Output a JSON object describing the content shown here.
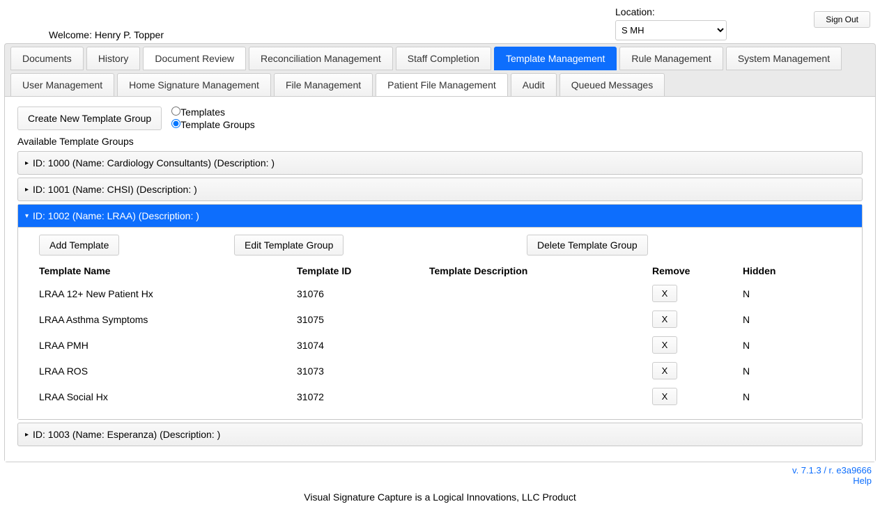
{
  "header": {
    "welcome_label": "Welcome:",
    "user_name": "Henry P. Topper",
    "location_label": "Location:",
    "location_value": "S MH",
    "signout": "Sign Out"
  },
  "tabs_row1": [
    "Documents",
    "History",
    "Document Review",
    "Reconciliation Management",
    "Staff Completion",
    "Template Management",
    "Rule Management",
    "System Management"
  ],
  "tabs_row2": [
    "User Management",
    "Home Signature Management",
    "File Management",
    "Patient File Management",
    "Audit",
    "Queued Messages"
  ],
  "active_tab": "Template Management",
  "white_tabs": [
    "Document Review",
    "Patient File Management"
  ],
  "content": {
    "create_btn": "Create New Template Group",
    "radio_templates": "Templates",
    "radio_groups": "Template Groups",
    "available_label": "Available Template Groups"
  },
  "groups": [
    {
      "header": "ID: 1000 (Name: Cardiology Consultants) (Description: )",
      "expanded": false
    },
    {
      "header": "ID: 1001 (Name: CHSI) (Description: )",
      "expanded": false
    },
    {
      "header": "ID: 1002 (Name: LRAA) (Description: )",
      "expanded": true,
      "actions": {
        "add": "Add Template",
        "edit": "Edit Template Group",
        "delete": "Delete Template Group"
      },
      "columns": {
        "name": "Template Name",
        "id": "Template ID",
        "desc": "Template Description",
        "remove": "Remove",
        "hidden": "Hidden"
      },
      "rows": [
        {
          "name": "LRAA 12+ New Patient Hx",
          "id": "31076",
          "desc": "",
          "remove": "X",
          "hidden": "N"
        },
        {
          "name": "LRAA Asthma Symptoms",
          "id": "31075",
          "desc": "",
          "remove": "X",
          "hidden": "N"
        },
        {
          "name": "LRAA PMH",
          "id": "31074",
          "desc": "",
          "remove": "X",
          "hidden": "N"
        },
        {
          "name": "LRAA ROS",
          "id": "31073",
          "desc": "",
          "remove": "X",
          "hidden": "N"
        },
        {
          "name": "LRAA Social Hx",
          "id": "31072",
          "desc": "",
          "remove": "X",
          "hidden": "N"
        }
      ]
    },
    {
      "header": "ID: 1003 (Name: Esperanza) (Description: )",
      "expanded": false
    }
  ],
  "footer": {
    "version": "v. 7.1.3 / r. e3a9666",
    "help": "Help",
    "product": "Visual Signature Capture is a Logical Innovations, LLC Product"
  }
}
